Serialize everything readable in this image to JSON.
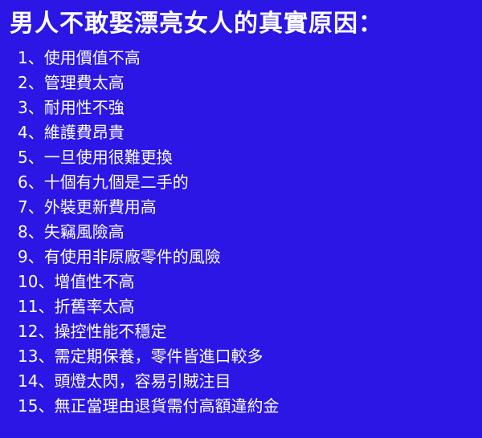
{
  "title": "男人不敢娶漂亮女人的真實原因：",
  "separator": "、",
  "items": [
    {
      "num": "1",
      "text": "使用價值不高"
    },
    {
      "num": "2",
      "text": "管理費太高"
    },
    {
      "num": "3",
      "text": "耐用性不強"
    },
    {
      "num": "4",
      "text": "維護費昂貴"
    },
    {
      "num": "5",
      "text": "一旦使用很難更換"
    },
    {
      "num": "6",
      "text": "十個有九個是二手的"
    },
    {
      "num": "7",
      "text": "外裝更新費用高"
    },
    {
      "num": "8",
      "text": "失竊風險高"
    },
    {
      "num": "9",
      "text": "有使用非原廠零件的風險"
    },
    {
      "num": "10",
      "text": "增值性不高"
    },
    {
      "num": "11",
      "text": "折舊率太高"
    },
    {
      "num": "12",
      "text": "操控性能不穩定"
    },
    {
      "num": "13",
      "text": "需定期保養，零件皆進口較多"
    },
    {
      "num": "14",
      "text": "頭燈太閃，容易引賊注目"
    },
    {
      "num": "15",
      "text": "無正當理由退貨需付高額違約金"
    }
  ],
  "colors": {
    "background": "#2b16e6",
    "text": "#ffffff"
  }
}
